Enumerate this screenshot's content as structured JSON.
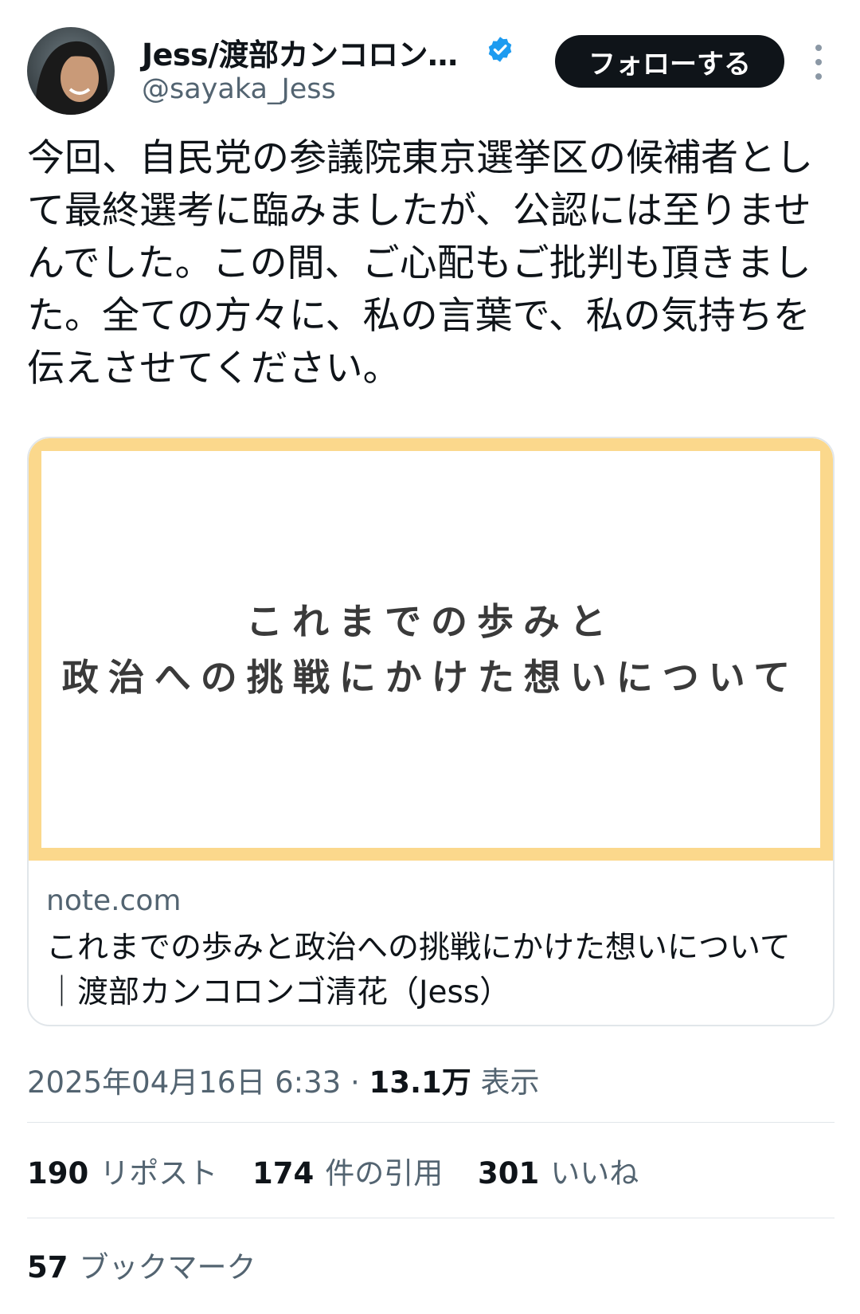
{
  "author": {
    "display_name": "Jess/渡部カンコロン…",
    "handle": "@sayaka_Jess",
    "verified": true
  },
  "follow_label": "フォローする",
  "tweet_text": "今回、自民党の参議院東京選挙区の候補者として最終選考に臨みましたが、公認には至りませんでした。この間、ご心配もご批判も頂きました。全ての方々に、私の言葉で、私の気持ちを伝えさせてください。",
  "card": {
    "image_lines": [
      "これまでの歩みと",
      "政治への挑戦にかけた想いについて"
    ],
    "domain": "note.com",
    "title": "これまでの歩みと政治への挑戦にかけた想いについて｜渡部カンコロンゴ清花（Jess）"
  },
  "meta": {
    "date": "2025年04月16日 6:33",
    "separator": "·",
    "views_count": "13.1万",
    "views_label": "表示"
  },
  "stats": {
    "reposts_count": "190",
    "reposts_label": "リポスト",
    "quotes_count": "174",
    "quotes_label": "件の引用",
    "likes_count": "301",
    "likes_label": "いいね",
    "bookmarks_count": "57",
    "bookmarks_label": "ブックマーク"
  },
  "colors": {
    "text_primary": "#0f1419",
    "text_secondary": "#536471",
    "verified_blue": "#1d9bf0",
    "card_frame": "#fbd88c",
    "divider": "#e1e6ea"
  }
}
